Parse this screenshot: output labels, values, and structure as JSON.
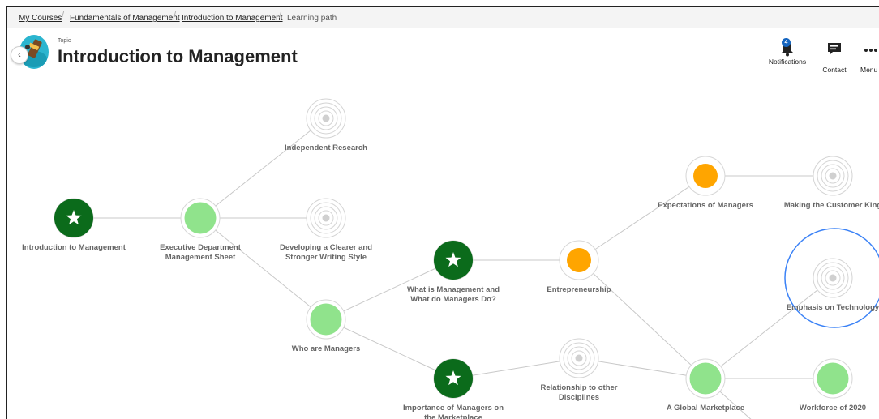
{
  "breadcrumb": {
    "items": [
      "My Courses",
      "Fundamentals of Management",
      "Introduction to Management",
      "Learning path"
    ]
  },
  "header": {
    "topic_label": "Topic",
    "title": "Introduction to Management",
    "back_icon": "chevron-left-icon"
  },
  "actions": {
    "notifications": {
      "label": "Notifications",
      "count": "4",
      "icon": "bell-icon"
    },
    "contact": {
      "label": "Contact",
      "icon": "chat-icon"
    },
    "menu": {
      "label": "Menu",
      "icon": "more-horizontal-icon"
    }
  },
  "colors": {
    "completed": "#0b6b1b",
    "in_progress_green": "#90e38c",
    "in_progress_orange": "#ffa500",
    "locked": "#d0d0d0",
    "highlight_ring": "#3b82f6"
  },
  "learning_path": {
    "nodes": [
      {
        "id": "intro",
        "status": "completed",
        "label": [
          "Introduction to Management"
        ]
      },
      {
        "id": "exec",
        "status": "in-progress-green",
        "label": [
          "Executive Department",
          "Management Sheet"
        ]
      },
      {
        "id": "indep",
        "status": "locked",
        "label": [
          "Independent Research"
        ]
      },
      {
        "id": "dev",
        "status": "locked",
        "label": [
          "Developing a Clearer and",
          "Stronger Writing Style"
        ]
      },
      {
        "id": "who",
        "status": "in-progress-green",
        "label": [
          "Who are Managers"
        ]
      },
      {
        "id": "what",
        "status": "completed",
        "label": [
          "What is Management and",
          "What do Managers Do?"
        ]
      },
      {
        "id": "imp",
        "status": "completed",
        "label": [
          "Importance of Managers on",
          "the Marketplace"
        ]
      },
      {
        "id": "entre",
        "status": "in-progress-orange",
        "label": [
          "Entrepreneurship"
        ]
      },
      {
        "id": "rel",
        "status": "locked",
        "label": [
          "Relationship to other",
          "Disciplines"
        ]
      },
      {
        "id": "expect",
        "status": "in-progress-orange",
        "label": [
          "Expectations of Managers"
        ]
      },
      {
        "id": "global",
        "status": "in-progress-green",
        "label": [
          "A Global Marketplace"
        ]
      },
      {
        "id": "custking",
        "status": "locked",
        "label": [
          "Making the Customer King"
        ]
      },
      {
        "id": "emph",
        "status": "locked",
        "highlighted": true,
        "label": [
          "Emphasis on Technology"
        ]
      },
      {
        "id": "work",
        "status": "in-progress-green",
        "label": [
          "Workforce of 2020"
        ]
      }
    ],
    "edges": [
      [
        "intro",
        "exec"
      ],
      [
        "exec",
        "indep"
      ],
      [
        "exec",
        "dev"
      ],
      [
        "exec",
        "who"
      ],
      [
        "who",
        "what"
      ],
      [
        "who",
        "imp"
      ],
      [
        "what",
        "entre"
      ],
      [
        "imp",
        "rel"
      ],
      [
        "entre",
        "expect"
      ],
      [
        "entre",
        "global"
      ],
      [
        "rel",
        "global"
      ],
      [
        "expect",
        "custking"
      ],
      [
        "global",
        "emph"
      ],
      [
        "global",
        "work"
      ],
      [
        "global",
        "below"
      ]
    ]
  }
}
